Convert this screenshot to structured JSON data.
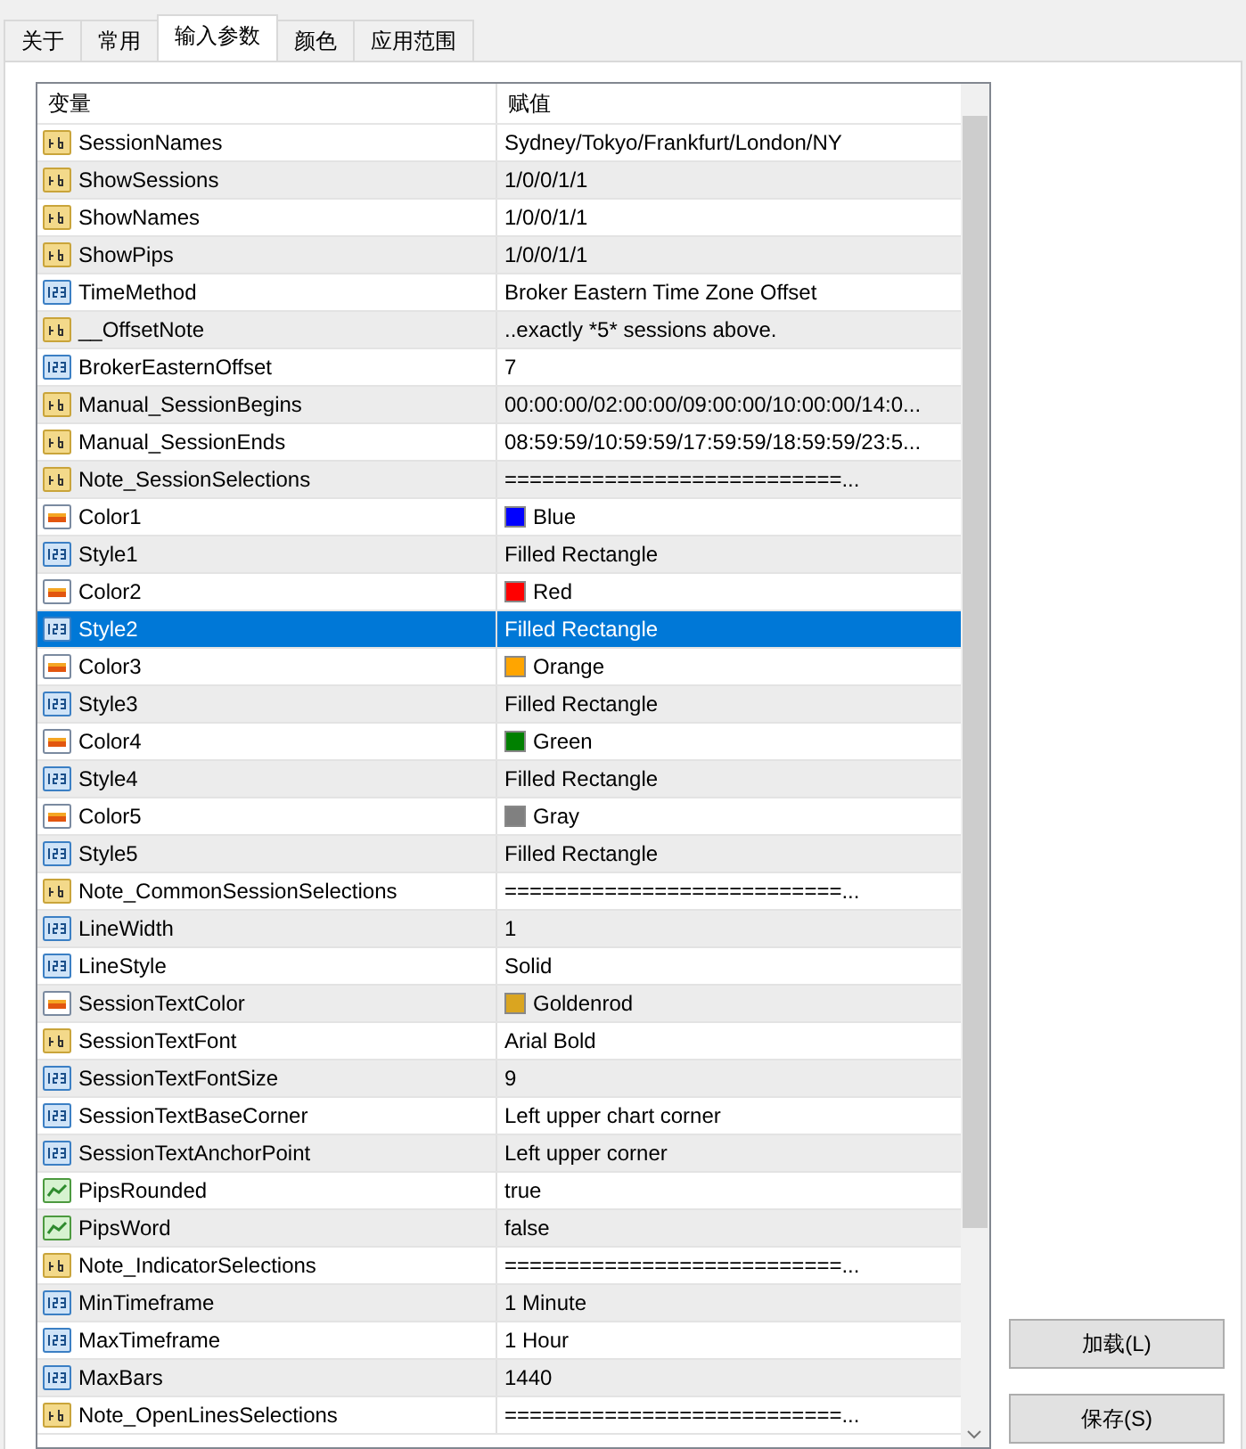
{
  "tabs": [
    {
      "label": "关于",
      "selected": false
    },
    {
      "label": "常用",
      "selected": false
    },
    {
      "label": "输入参数",
      "selected": true
    },
    {
      "label": "颜色",
      "selected": false
    },
    {
      "label": "应用范围",
      "selected": false
    }
  ],
  "table": {
    "columns": [
      "变量",
      "赋值"
    ],
    "rows": [
      {
        "kind": "string",
        "name": "SessionNames",
        "value": "Sydney/Tokyo/Frankfurt/London/NY",
        "selected": false
      },
      {
        "kind": "string",
        "name": "ShowSessions",
        "value": "1/0/0/1/1",
        "selected": false
      },
      {
        "kind": "string",
        "name": "ShowNames",
        "value": "1/0/0/1/1",
        "selected": false
      },
      {
        "kind": "string",
        "name": "ShowPips",
        "value": "1/0/0/1/1",
        "selected": false
      },
      {
        "kind": "number",
        "name": "TimeMethod",
        "value": "Broker Eastern Time Zone Offset",
        "selected": false
      },
      {
        "kind": "string",
        "name": "__OffsetNote",
        "value": "..exactly *5* sessions above.",
        "selected": false
      },
      {
        "kind": "number",
        "name": "BrokerEasternOffset",
        "value": "7",
        "selected": false
      },
      {
        "kind": "string",
        "name": "Manual_SessionBegins",
        "value": "00:00:00/02:00:00/09:00:00/10:00:00/14:0...",
        "selected": false
      },
      {
        "kind": "string",
        "name": "Manual_SessionEnds",
        "value": "08:59:59/10:59:59/17:59:59/18:59:59/23:5...",
        "selected": false
      },
      {
        "kind": "string",
        "name": "Note_SessionSelections",
        "value": "===========================...",
        "selected": false
      },
      {
        "kind": "color",
        "name": "Color1",
        "value": "Blue",
        "color": "#0000ff",
        "selected": false
      },
      {
        "kind": "number",
        "name": "Style1",
        "value": "Filled Rectangle",
        "selected": false
      },
      {
        "kind": "color",
        "name": "Color2",
        "value": "Red",
        "color": "#ff0000",
        "selected": false
      },
      {
        "kind": "number",
        "name": "Style2",
        "value": "Filled Rectangle",
        "selected": true
      },
      {
        "kind": "color",
        "name": "Color3",
        "value": "Orange",
        "color": "#ffa500",
        "selected": false
      },
      {
        "kind": "number",
        "name": "Style3",
        "value": "Filled Rectangle",
        "selected": false
      },
      {
        "kind": "color",
        "name": "Color4",
        "value": "Green",
        "color": "#008000",
        "selected": false
      },
      {
        "kind": "number",
        "name": "Style4",
        "value": "Filled Rectangle",
        "selected": false
      },
      {
        "kind": "color",
        "name": "Color5",
        "value": "Gray",
        "color": "#808080",
        "selected": false
      },
      {
        "kind": "number",
        "name": "Style5",
        "value": "Filled Rectangle",
        "selected": false
      },
      {
        "kind": "string",
        "name": "Note_CommonSessionSelections",
        "value": "===========================...",
        "selected": false
      },
      {
        "kind": "number",
        "name": "LineWidth",
        "value": "1",
        "selected": false
      },
      {
        "kind": "number",
        "name": "LineStyle",
        "value": "Solid",
        "selected": false
      },
      {
        "kind": "color",
        "name": "SessionTextColor",
        "value": "Goldenrod",
        "color": "#daa520",
        "selected": false
      },
      {
        "kind": "string",
        "name": "SessionTextFont",
        "value": "Arial Bold",
        "selected": false
      },
      {
        "kind": "number",
        "name": "SessionTextFontSize",
        "value": "9",
        "selected": false
      },
      {
        "kind": "number",
        "name": "SessionTextBaseCorner",
        "value": "Left upper chart corner",
        "selected": false
      },
      {
        "kind": "number",
        "name": "SessionTextAnchorPoint",
        "value": "Left upper corner",
        "selected": false
      },
      {
        "kind": "bool",
        "name": "PipsRounded",
        "value": "true",
        "selected": false
      },
      {
        "kind": "bool",
        "name": "PipsWord",
        "value": "false",
        "selected": false
      },
      {
        "kind": "string",
        "name": "Note_IndicatorSelections",
        "value": "===========================...",
        "selected": false
      },
      {
        "kind": "number",
        "name": "MinTimeframe",
        "value": "1 Minute",
        "selected": false
      },
      {
        "kind": "number",
        "name": "MaxTimeframe",
        "value": "1 Hour",
        "selected": false
      },
      {
        "kind": "number",
        "name": "MaxBars",
        "value": "1440",
        "selected": false
      },
      {
        "kind": "string",
        "name": "Note_OpenLinesSelections",
        "value": "===========================...",
        "selected": false
      }
    ]
  },
  "buttons": [
    "加载(L)",
    "保存(S)"
  ]
}
